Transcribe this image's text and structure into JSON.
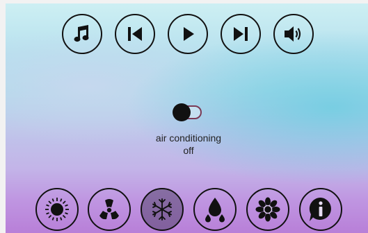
{
  "media_controls": [
    "music-icon",
    "previous-icon",
    "play-icon",
    "next-icon",
    "volume-icon"
  ],
  "climate": {
    "toggle_state": "off",
    "label": "air conditioning",
    "status": "off"
  },
  "mode_buttons": [
    "sun-icon",
    "fan-icon",
    "snowflake-icon",
    "water-drops-icon",
    "flower-icon",
    "info-icon"
  ],
  "active_mode": "snowflake-icon"
}
